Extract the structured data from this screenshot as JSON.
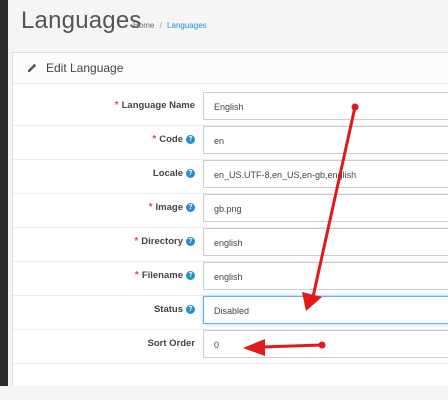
{
  "header": {
    "title": "Languages",
    "breadcrumb": {
      "home": "Home",
      "separator": "/",
      "current": "Languages"
    }
  },
  "panel": {
    "heading": "Edit Language"
  },
  "form": {
    "fields": [
      {
        "label": "Language Name",
        "required": true,
        "help": false,
        "value": "English"
      },
      {
        "label": "Code",
        "required": true,
        "help": true,
        "value": "en"
      },
      {
        "label": "Locale",
        "required": false,
        "help": true,
        "value": "en_US.UTF-8,en_US,en-gb,english"
      },
      {
        "label": "Image",
        "required": true,
        "help": true,
        "value": "gb.png"
      },
      {
        "label": "Directory",
        "required": true,
        "help": true,
        "value": "english"
      },
      {
        "label": "Filename",
        "required": true,
        "help": true,
        "value": "english"
      },
      {
        "label": "Status",
        "required": false,
        "help": true,
        "value": "Disabled"
      },
      {
        "label": "Sort Order",
        "required": false,
        "help": false,
        "value": "0"
      }
    ]
  },
  "colors": {
    "accent": "#1e91cf",
    "required": "#e3503e",
    "annotation_arrow": "#e0191b"
  },
  "icons": {
    "heading": "pencil-icon",
    "help": "question-circle-icon"
  }
}
